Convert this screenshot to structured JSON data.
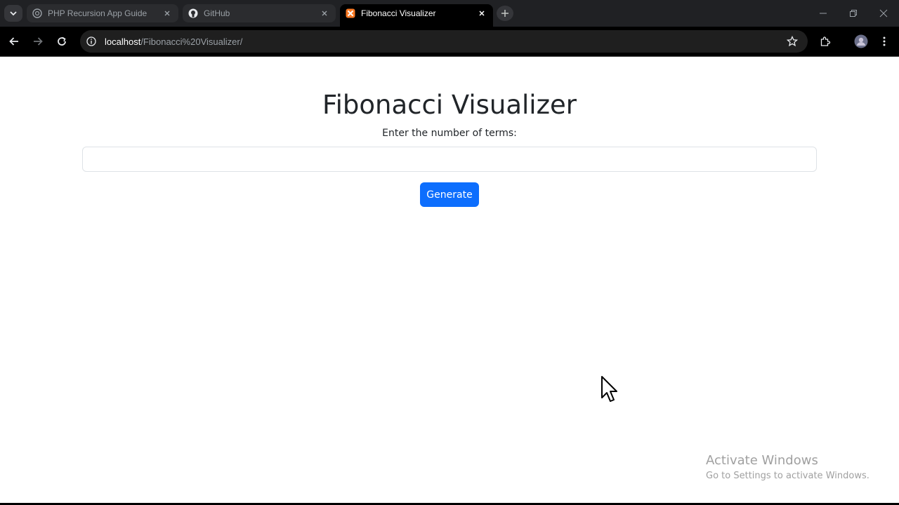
{
  "browser": {
    "tabs": [
      {
        "label": "PHP Recursion App Guide",
        "icon": "openai-icon",
        "active": false
      },
      {
        "label": "GitHub",
        "icon": "github-icon",
        "active": false
      },
      {
        "label": "Fibonacci Visualizer",
        "icon": "xampp-icon",
        "active": true
      }
    ],
    "url_host": "localhost",
    "url_path": "/Fibonacci%20Visualizer/"
  },
  "page": {
    "title": "Fibonacci Visualizer",
    "prompt": "Enter the number of terms:",
    "input_value": "",
    "generate_label": "Generate"
  },
  "watermark": {
    "line1": "Activate Windows",
    "line2": "Go to Settings to activate Windows."
  },
  "colors": {
    "primary": "#0d6efd",
    "text": "#212529",
    "chrome_dark": "#202124"
  }
}
